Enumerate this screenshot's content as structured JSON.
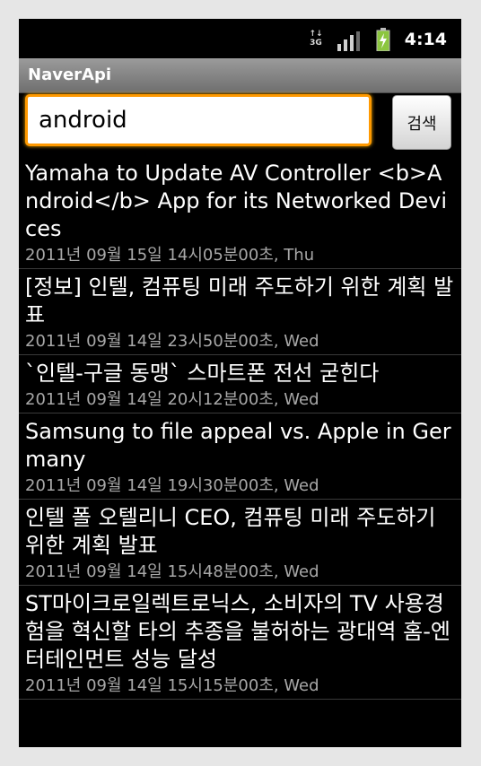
{
  "status_bar": {
    "network_label": "3G",
    "time": "4:14",
    "icons": [
      "network-3g-icon",
      "signal-strength-icon",
      "battery-charging-icon"
    ]
  },
  "app": {
    "title": "NaverApi"
  },
  "search": {
    "value": "android",
    "button_label": "검색"
  },
  "results": [
    {
      "title": "Yamaha to Update AV Controller <b>Android</b> App for its Networked Devices",
      "date": "2011년 09월 15일 14시05분00초, Thu"
    },
    {
      "title": "[정보] 인텔, 컴퓨팅 미래 주도하기 위한 계획 발표",
      "date": "2011년 09월 14일 23시50분00초, Wed"
    },
    {
      "title": "`인텔-구글 동맹` 스마트폰 전선 굳힌다",
      "date": "2011년 09월 14일 20시12분00초, Wed"
    },
    {
      "title": "Samsung to file appeal vs. Apple in Germany",
      "date": "2011년 09월 14일 19시30분00초, Wed"
    },
    {
      "title": "인텔 폴 오텔리니 CEO, 컴퓨팅 미래 주도하기 위한 계획 발표",
      "date": "2011년 09월 14일 15시48분00초, Wed"
    },
    {
      "title": "ST마이크로일렉트로닉스, 소비자의 TV 사용경험을 혁신할 타의 추종을 불허하는 광대역 홈-엔터테인먼트 성능 달성",
      "date": "2011년 09월 14일 15시15분00초, Wed"
    }
  ],
  "colors": {
    "background": "#000000",
    "accent_focus": "#ff9900",
    "battery": "#8cc63f",
    "date_text": "#a8a8a8"
  }
}
